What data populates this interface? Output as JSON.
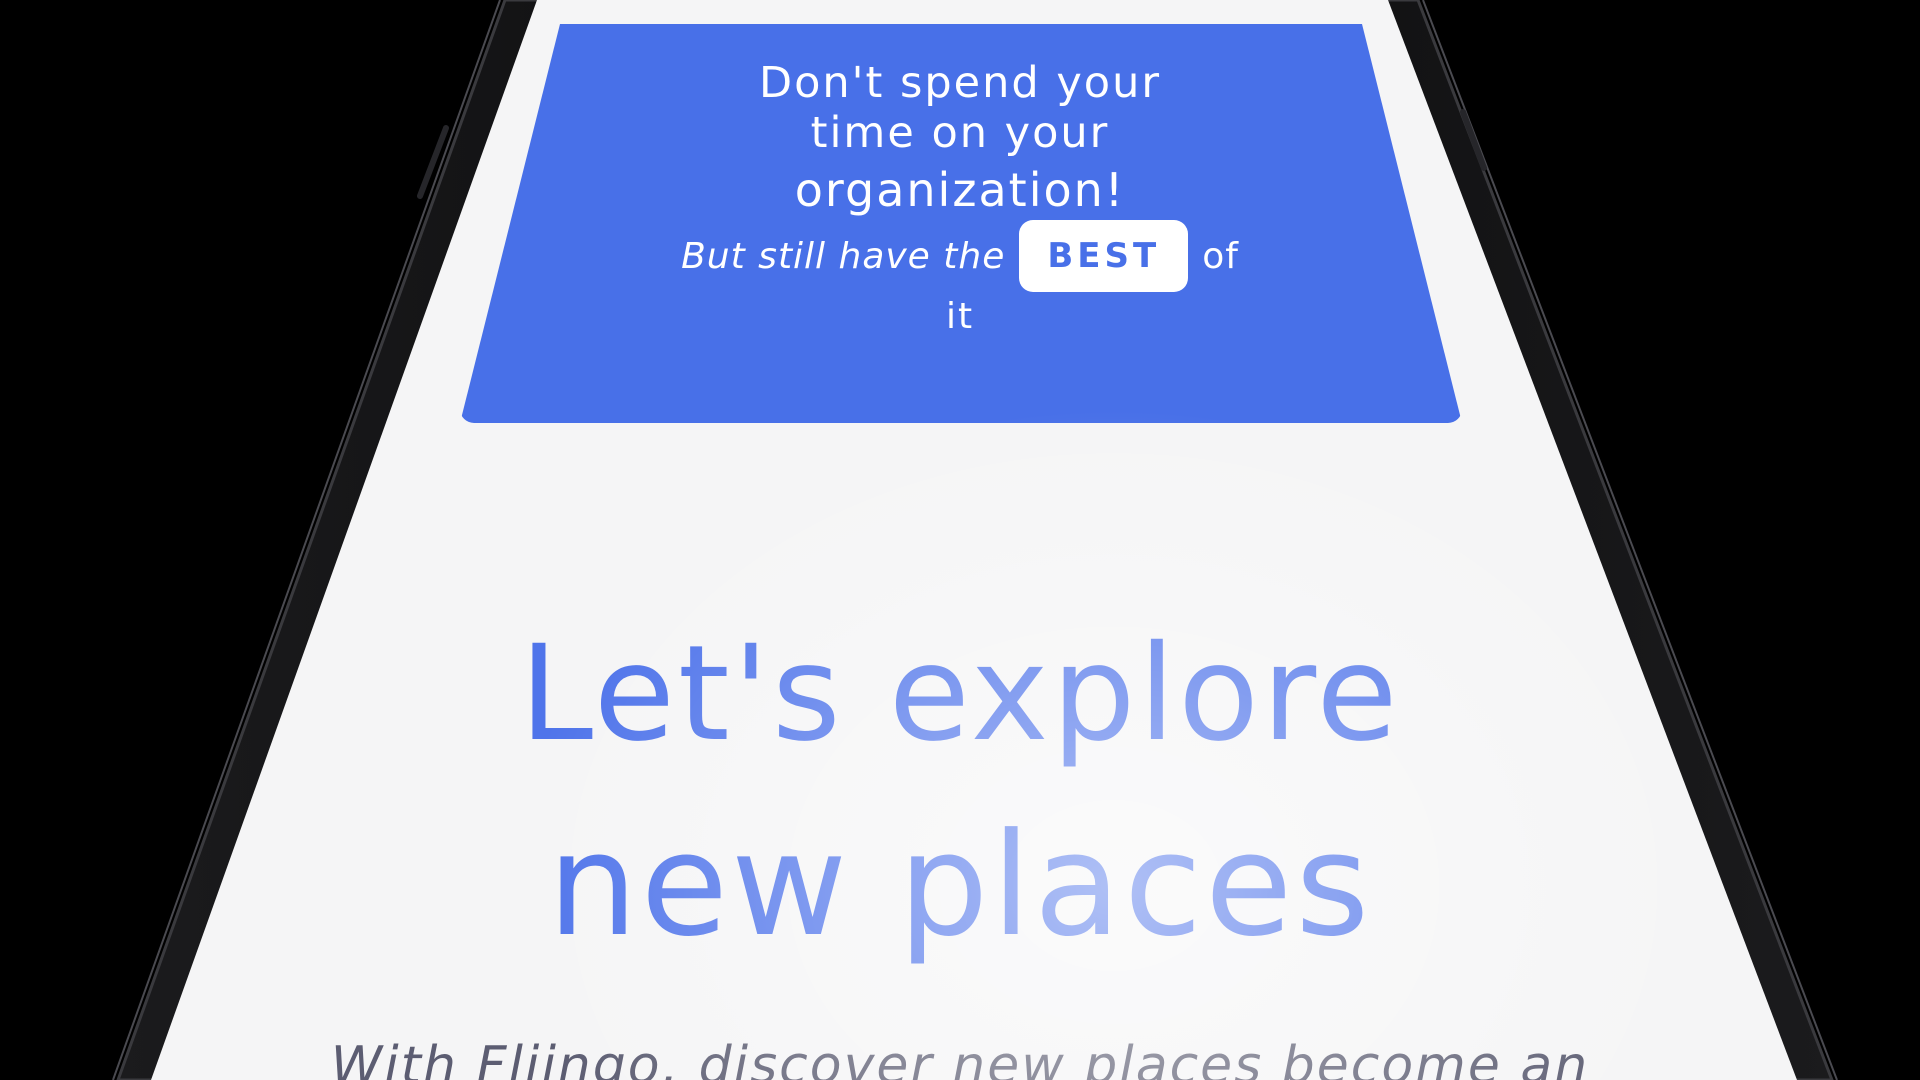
{
  "banner": {
    "line1": "Don't spend your",
    "line2": "time on your",
    "line3": "organization!",
    "sub_before": "But still have the",
    "badge": "BEST",
    "sub_after": "of",
    "sub_last": "it"
  },
  "hero": {
    "line1": "Let's explore",
    "line2": "new places",
    "subtitle": "With Flijngo, discover new places become an"
  },
  "colors": {
    "accent": "#4870e8",
    "heading": "#4f74ea",
    "body_text": "#5c5d72",
    "background": "#f5f5f6",
    "frame": "#000000"
  }
}
